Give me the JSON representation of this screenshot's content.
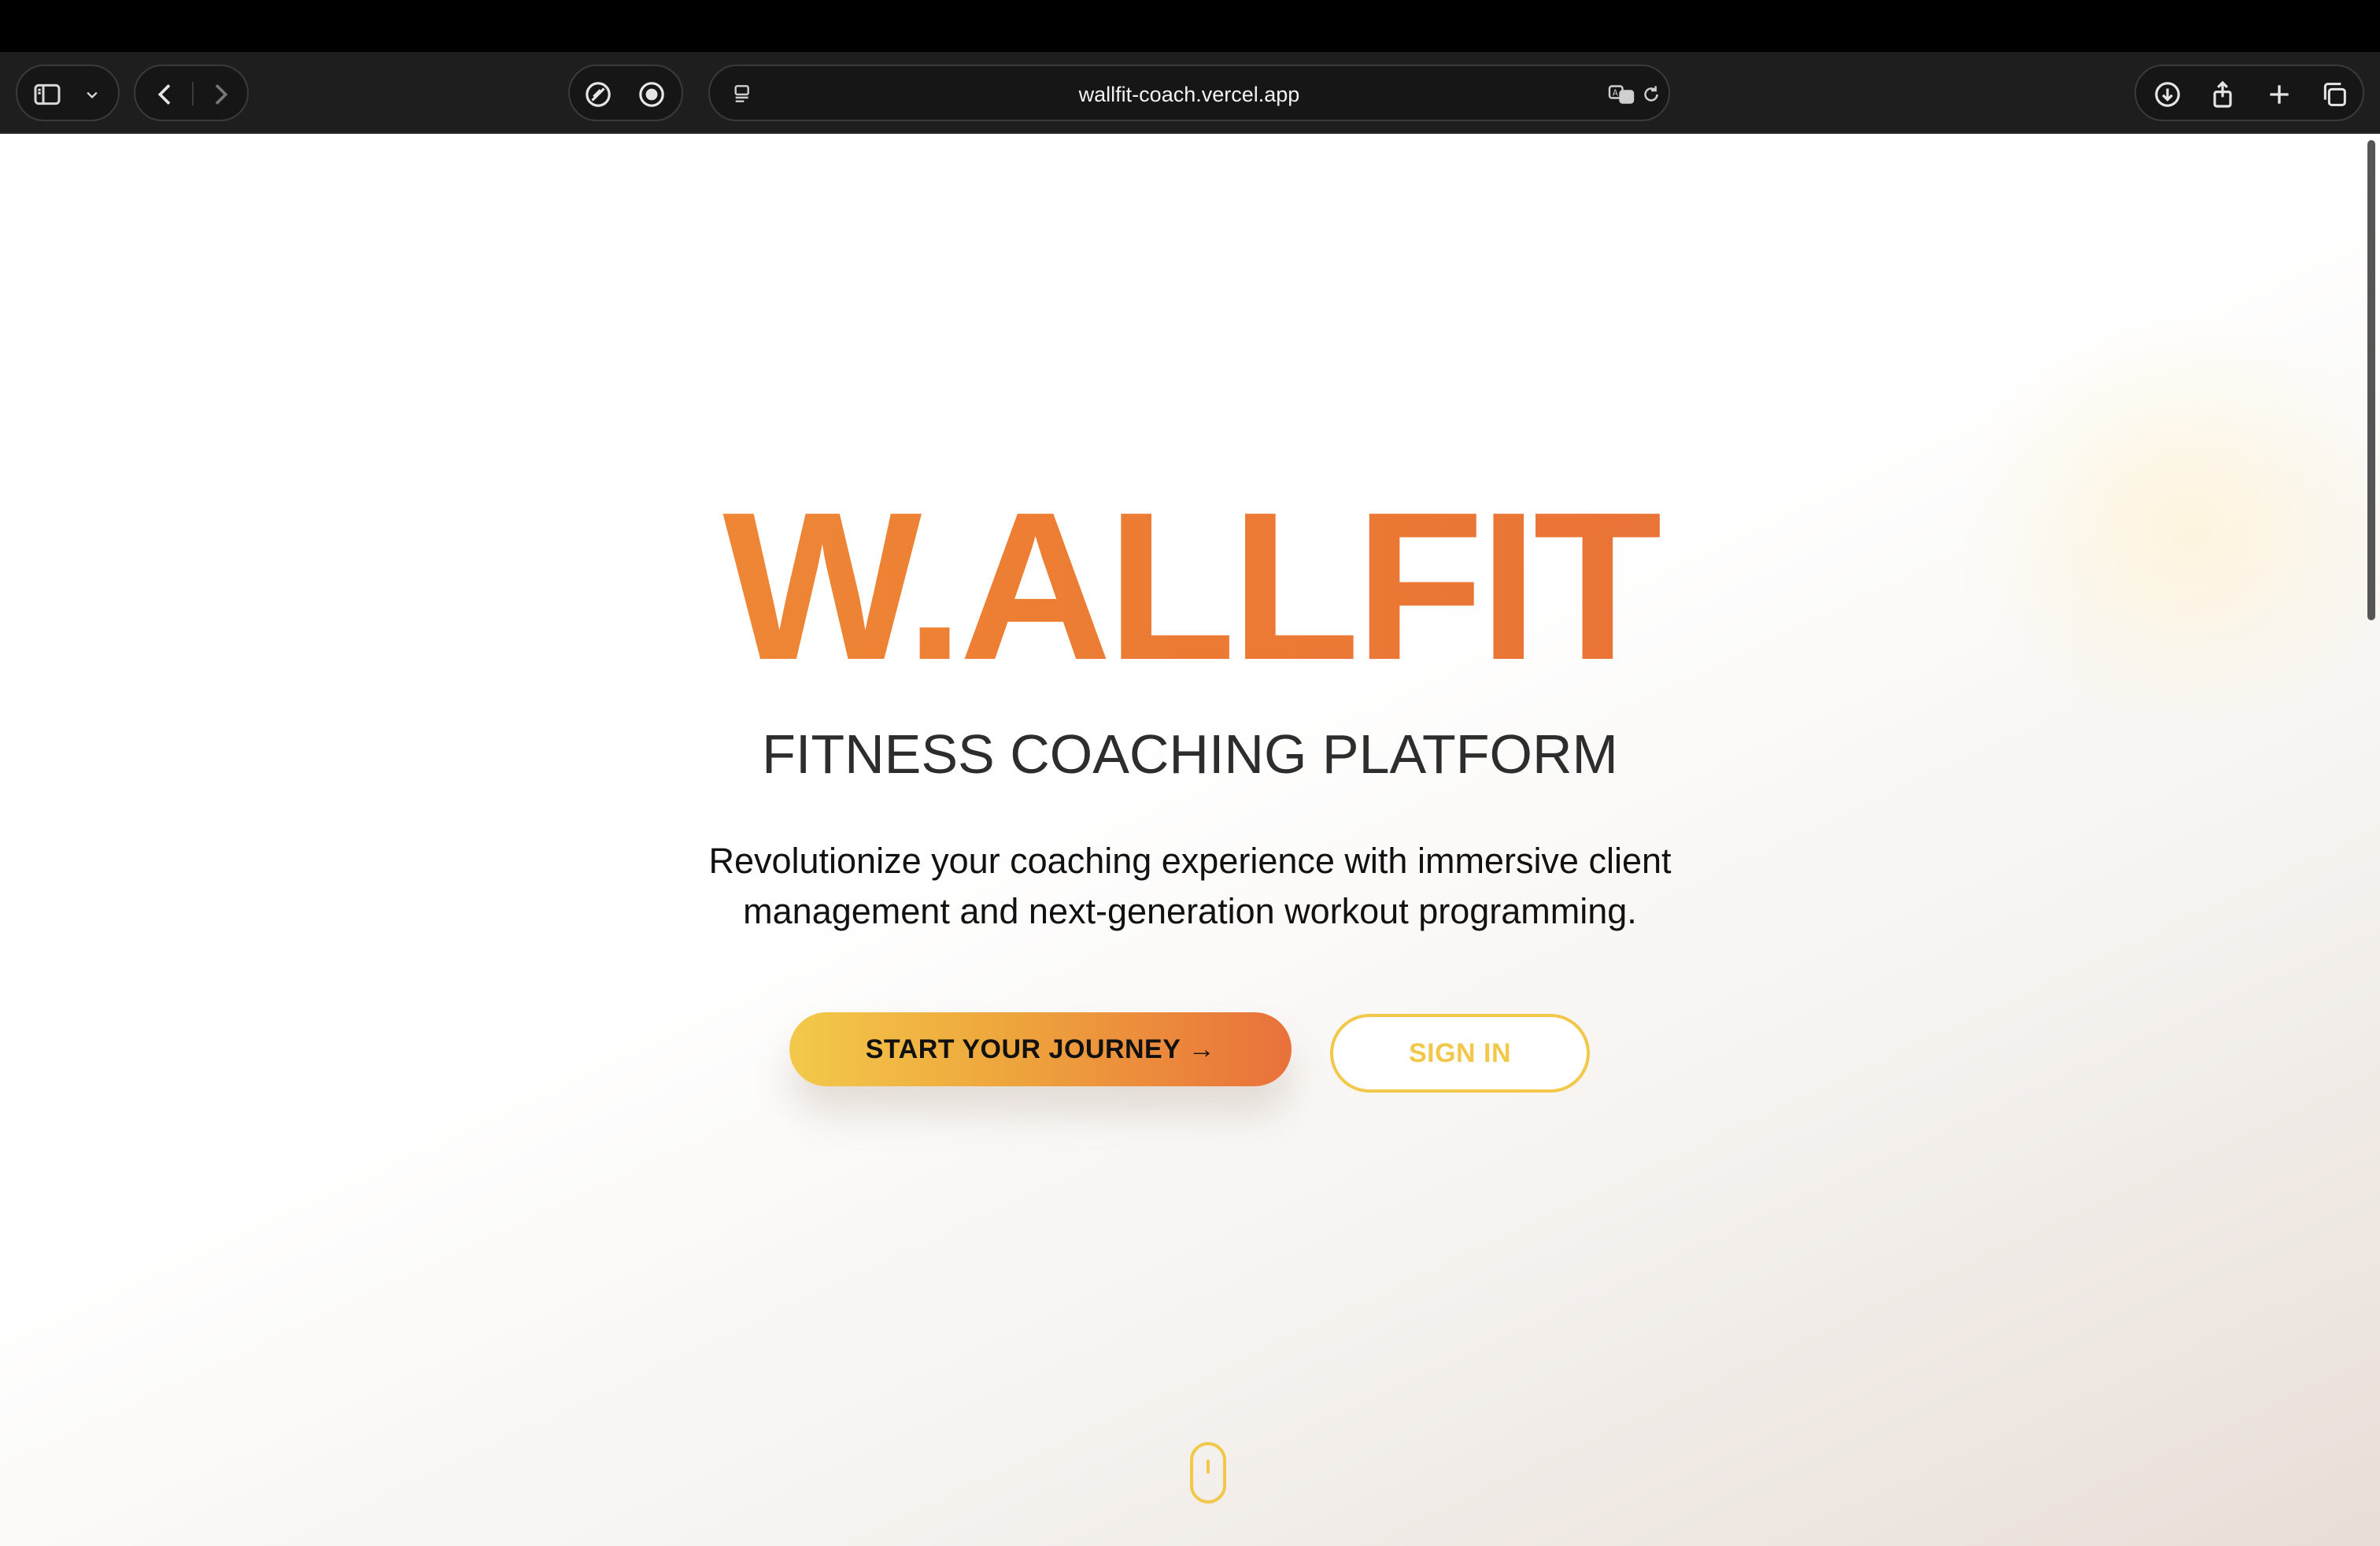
{
  "browser": {
    "url": "wallfit-coach.vercel.app",
    "icons": {
      "sidebar": "sidebar-icon",
      "sidebar_menu": "chevron-down-icon",
      "back": "chevron-left-icon",
      "forward": "chevron-right-icon",
      "extension_1": "compass-slash-icon",
      "extension_2": "target-icon",
      "page_menu": "page-menu-icon",
      "translate": "translate-icon",
      "reload": "reload-icon",
      "downloads": "download-icon",
      "share": "share-icon",
      "new_tab": "plus-icon",
      "tab_overview": "tabs-icon"
    }
  },
  "hero": {
    "brand": "W.ALLFIT",
    "subtitle": "FITNESS COACHING PLATFORM",
    "description": "Revolutionize your coaching experience with immersive client management and next-generation workout programming.",
    "primary_cta": "START YOUR JOURNEY →",
    "secondary_cta": "SIGN IN"
  },
  "colors": {
    "accent_orange": "#ec7a33",
    "accent_yellow": "#f2c84b",
    "toolbar_bg": "#1e1e1e"
  }
}
